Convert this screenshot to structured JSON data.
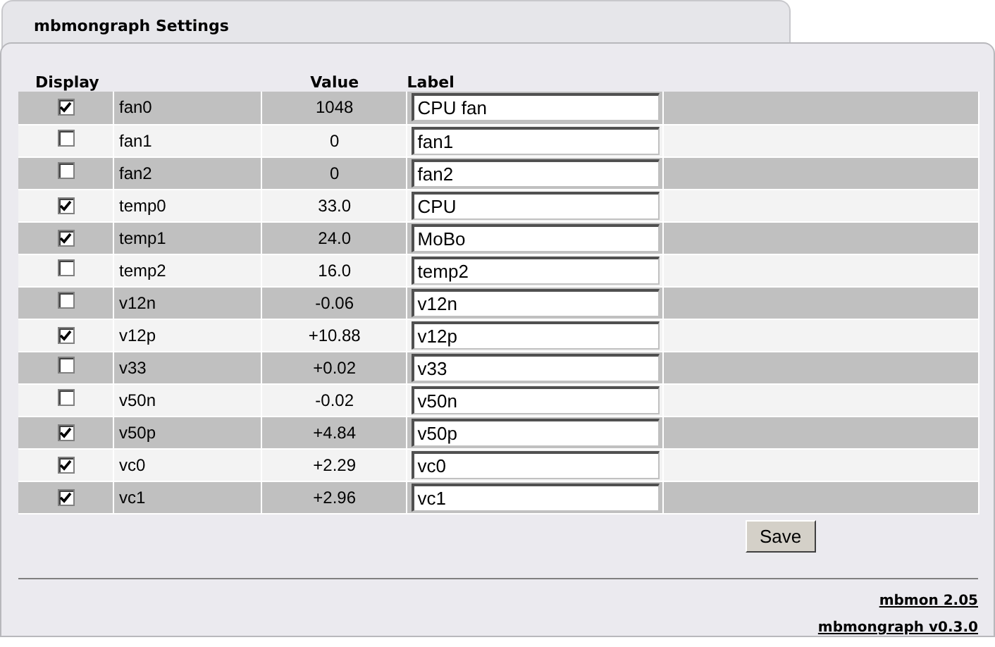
{
  "window": {
    "title": "mbmongraph Settings"
  },
  "table": {
    "columns": [
      "Display",
      "Value",
      "Label"
    ],
    "rows": [
      {
        "display": true,
        "name": "fan0",
        "value": "1048",
        "label": "CPU fan"
      },
      {
        "display": false,
        "name": "fan1",
        "value": "0",
        "label": "fan1"
      },
      {
        "display": false,
        "name": "fan2",
        "value": "0",
        "label": "fan2"
      },
      {
        "display": true,
        "name": "temp0",
        "value": "33.0",
        "label": "CPU"
      },
      {
        "display": true,
        "name": "temp1",
        "value": "24.0",
        "label": "MoBo"
      },
      {
        "display": false,
        "name": "temp2",
        "value": "16.0",
        "label": "temp2"
      },
      {
        "display": false,
        "name": "v12n",
        "value": "-0.06",
        "label": "v12n"
      },
      {
        "display": true,
        "name": "v12p",
        "value": "+10.88",
        "label": "v12p"
      },
      {
        "display": false,
        "name": "v33",
        "value": "+0.02",
        "label": "v33"
      },
      {
        "display": false,
        "name": "v50n",
        "value": "-0.02",
        "label": "v50n"
      },
      {
        "display": true,
        "name": "v50p",
        "value": "+4.84",
        "label": "v50p"
      },
      {
        "display": true,
        "name": "vc0",
        "value": "+2.29",
        "label": "vc0"
      },
      {
        "display": true,
        "name": "vc1",
        "value": "+2.96",
        "label": "vc1"
      }
    ]
  },
  "buttons": [
    "Save"
  ],
  "footer_links": [
    "mbmon 2.05",
    "mbmongraph v0.3.0"
  ]
}
